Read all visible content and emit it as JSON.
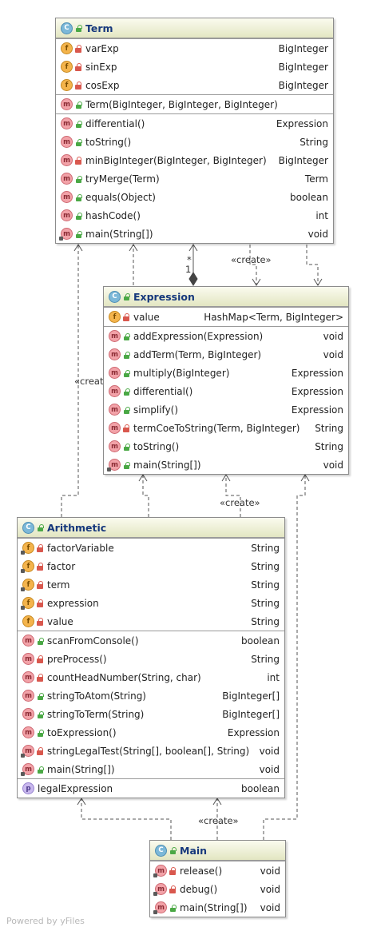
{
  "classes": {
    "term": {
      "name": "Term",
      "fields": [
        {
          "name": "varExp",
          "type": "BigInteger"
        },
        {
          "name": "sinExp",
          "type": "BigInteger"
        },
        {
          "name": "cosExp",
          "type": "BigInteger"
        }
      ],
      "constructors": [
        {
          "name": "Term(BigInteger, BigInteger, BigInteger)",
          "type": ""
        }
      ],
      "methods": [
        {
          "name": "differential()",
          "type": "Expression"
        },
        {
          "name": "toString()",
          "type": "String"
        },
        {
          "name": "minBigInteger(BigInteger, BigInteger)",
          "type": "BigInteger"
        },
        {
          "name": "tryMerge(Term)",
          "type": "Term"
        },
        {
          "name": "equals(Object)",
          "type": "boolean"
        },
        {
          "name": "hashCode()",
          "type": "int"
        },
        {
          "name": "main(String[])",
          "type": "void"
        }
      ]
    },
    "expression": {
      "name": "Expression",
      "fields": [
        {
          "name": "value",
          "type": "HashMap<Term, BigInteger>"
        }
      ],
      "methods": [
        {
          "name": "addExpression(Expression)",
          "type": "void"
        },
        {
          "name": "addTerm(Term, BigInteger)",
          "type": "void"
        },
        {
          "name": "multiply(BigInteger)",
          "type": "Expression"
        },
        {
          "name": "differential()",
          "type": "Expression"
        },
        {
          "name": "simplify()",
          "type": "Expression"
        },
        {
          "name": "termCoeToString(Term, BigInteger)",
          "type": "String"
        },
        {
          "name": "toString()",
          "type": "String"
        },
        {
          "name": "main(String[])",
          "type": "void"
        }
      ]
    },
    "arithmetic": {
      "name": "Arithmetic",
      "fields": [
        {
          "name": "factorVariable",
          "type": "String"
        },
        {
          "name": "factor",
          "type": "String"
        },
        {
          "name": "term",
          "type": "String"
        },
        {
          "name": "expression",
          "type": "String"
        },
        {
          "name": "value",
          "type": "String"
        }
      ],
      "methods": [
        {
          "name": "scanFromConsole()",
          "type": "boolean"
        },
        {
          "name": "preProcess()",
          "type": "String"
        },
        {
          "name": "countHeadNumber(String, char)",
          "type": "int"
        },
        {
          "name": "stringToAtom(String)",
          "type": "BigInteger[]"
        },
        {
          "name": "stringToTerm(String)",
          "type": "BigInteger[]"
        },
        {
          "name": "toExpression()",
          "type": "Expression"
        },
        {
          "name": "stringLegalTest(String[], boolean[], String)",
          "type": "void"
        },
        {
          "name": "main(String[])",
          "type": "void"
        }
      ],
      "properties": [
        {
          "name": "legalExpression",
          "type": "boolean"
        }
      ]
    },
    "main": {
      "name": "Main",
      "methods": [
        {
          "name": "release()",
          "type": "void"
        },
        {
          "name": "debug()",
          "type": "void"
        },
        {
          "name": "main(String[])",
          "type": "void"
        }
      ]
    }
  },
  "edge_labels": {
    "create_1": "«create»",
    "create_2": "«create»",
    "create_3": "«create»",
    "create_4": "«create»",
    "multiplicity_star": "*",
    "multiplicity_one": "1"
  },
  "footer": "Powered by yFiles",
  "colors": {
    "class_name": "#16387c",
    "header_top": "#fbfbef",
    "header_bottom": "#e3e6c2",
    "edge": "#555555"
  }
}
